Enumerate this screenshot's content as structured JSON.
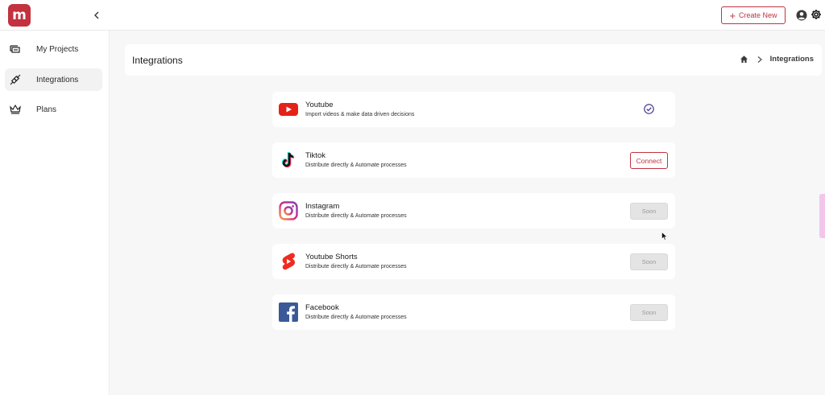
{
  "app": {
    "logo_letter": "m",
    "brand_color": "#c2323f"
  },
  "topbar": {
    "create_label": "Create New",
    "create_icon": "plus-icon",
    "user_icon": "user-circle-icon",
    "settings_icon": "gear-icon"
  },
  "sidebar": {
    "items": [
      {
        "label": "My Projects",
        "icon": "projects-stack-icon",
        "active": false
      },
      {
        "label": "Integrations",
        "icon": "integrations-plug-icon",
        "active": true
      },
      {
        "label": "Plans",
        "icon": "crown-icon",
        "active": false
      }
    ]
  },
  "header": {
    "title": "Integrations",
    "breadcrumb_current": "Integrations",
    "home_icon": "home-icon"
  },
  "integrations": [
    {
      "name": "Youtube",
      "description": "Import videos & make data driven decisions",
      "status": "connected"
    },
    {
      "name": "Tiktok",
      "description": "Distribute directly & Automate processes",
      "status": "connect",
      "action_label": "Connect"
    },
    {
      "name": "Instagram",
      "description": "Distribute directly & Automate processes",
      "status": "soon",
      "action_label": "Soon"
    },
    {
      "name": "Youtube Shorts",
      "description": "Distribute directly & Automate processes",
      "status": "soon",
      "action_label": "Soon"
    },
    {
      "name": "Facebook",
      "description": "Distribute directly & Automate processes",
      "status": "soon",
      "action_label": "Soon"
    }
  ]
}
